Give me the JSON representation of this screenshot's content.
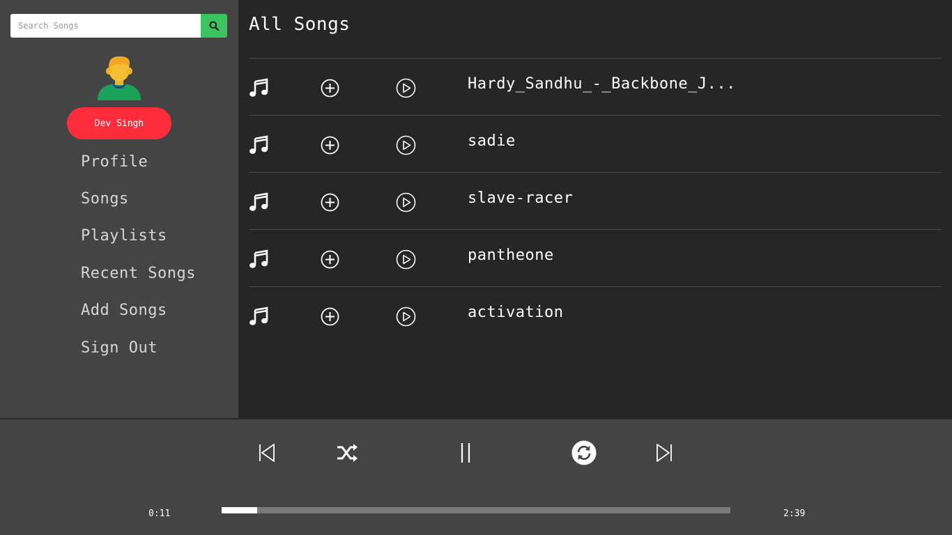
{
  "search": {
    "placeholder": "Search Songs"
  },
  "user": {
    "name": "Dev Singh"
  },
  "nav": [
    {
      "label": "Profile"
    },
    {
      "label": "Songs"
    },
    {
      "label": "Playlists"
    },
    {
      "label": "Recent Songs"
    },
    {
      "label": "Add Songs"
    },
    {
      "label": "Sign Out"
    }
  ],
  "main": {
    "title": "All Songs",
    "songs": [
      {
        "name": "Hardy_Sandhu_-_Backbone_J..."
      },
      {
        "name": "sadie"
      },
      {
        "name": "slave-racer"
      },
      {
        "name": "pantheone"
      },
      {
        "name": "activation"
      }
    ]
  },
  "player": {
    "current_time": "0:11",
    "total_time": "2:39",
    "progress": 0.07,
    "controls": [
      "previous-icon",
      "shuffle-icon",
      "pause-icon",
      "repeat-icon",
      "next-icon"
    ]
  },
  "colors": {
    "accent_green": "#3cc463",
    "user_pill": "#ff2d3c",
    "sidebar_bg": "#444444",
    "main_bg": "#262626"
  }
}
